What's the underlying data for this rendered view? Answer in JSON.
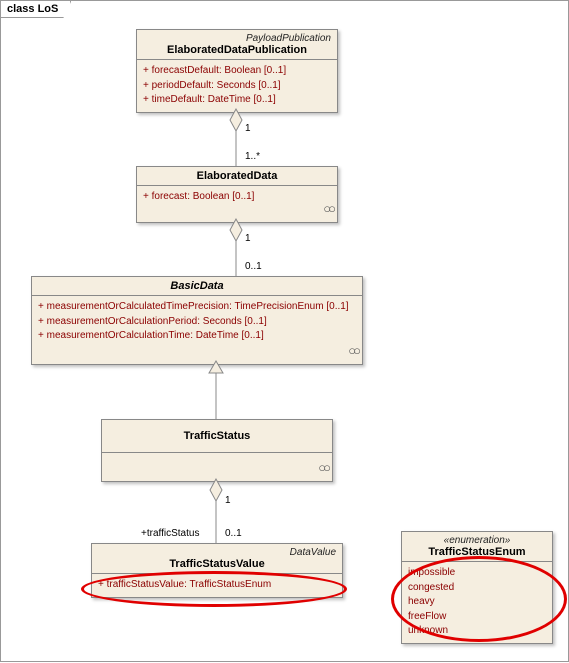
{
  "frame": {
    "label": "class LoS"
  },
  "classes": {
    "edp": {
      "stereotype": "PayloadPublication",
      "name": "ElaboratedDataPublication",
      "attrs": [
        "+   forecastDefault:  Boolean [0..1]",
        "+   periodDefault:  Seconds [0..1]",
        "+   timeDefault:  DateTime [0..1]"
      ]
    },
    "ed": {
      "name": "ElaboratedData",
      "attrs": [
        "+   forecast:  Boolean [0..1]"
      ]
    },
    "bd": {
      "name": "BasicData",
      "attrs": [
        "+   measurementOrCalculatedTimePrecision:  TimePrecisionEnum [0..1]",
        "+   measurementOrCalculationPeriod:  Seconds [0..1]",
        "+   measurementOrCalculationTime:  DateTime [0..1]"
      ]
    },
    "ts": {
      "name": "TrafficStatus"
    },
    "tsv": {
      "stereotype": "DataValue",
      "name": "TrafficStatusValue",
      "attrs": [
        "+   trafficStatusValue:  TrafficStatusEnum"
      ]
    },
    "tse": {
      "stereotype": "«enumeration»",
      "name": "TrafficStatusEnum",
      "values": [
        "impossible",
        "congested",
        "heavy",
        "freeFlow",
        "unknown"
      ]
    }
  },
  "mult": {
    "edp_bottom": "1",
    "ed_top": "1..*",
    "ed_bottom": "1",
    "bd_top": "0..1",
    "ts_bottom": "1",
    "tsv_top": "0..1"
  },
  "role": {
    "tsv_top": "+trafficStatus"
  }
}
